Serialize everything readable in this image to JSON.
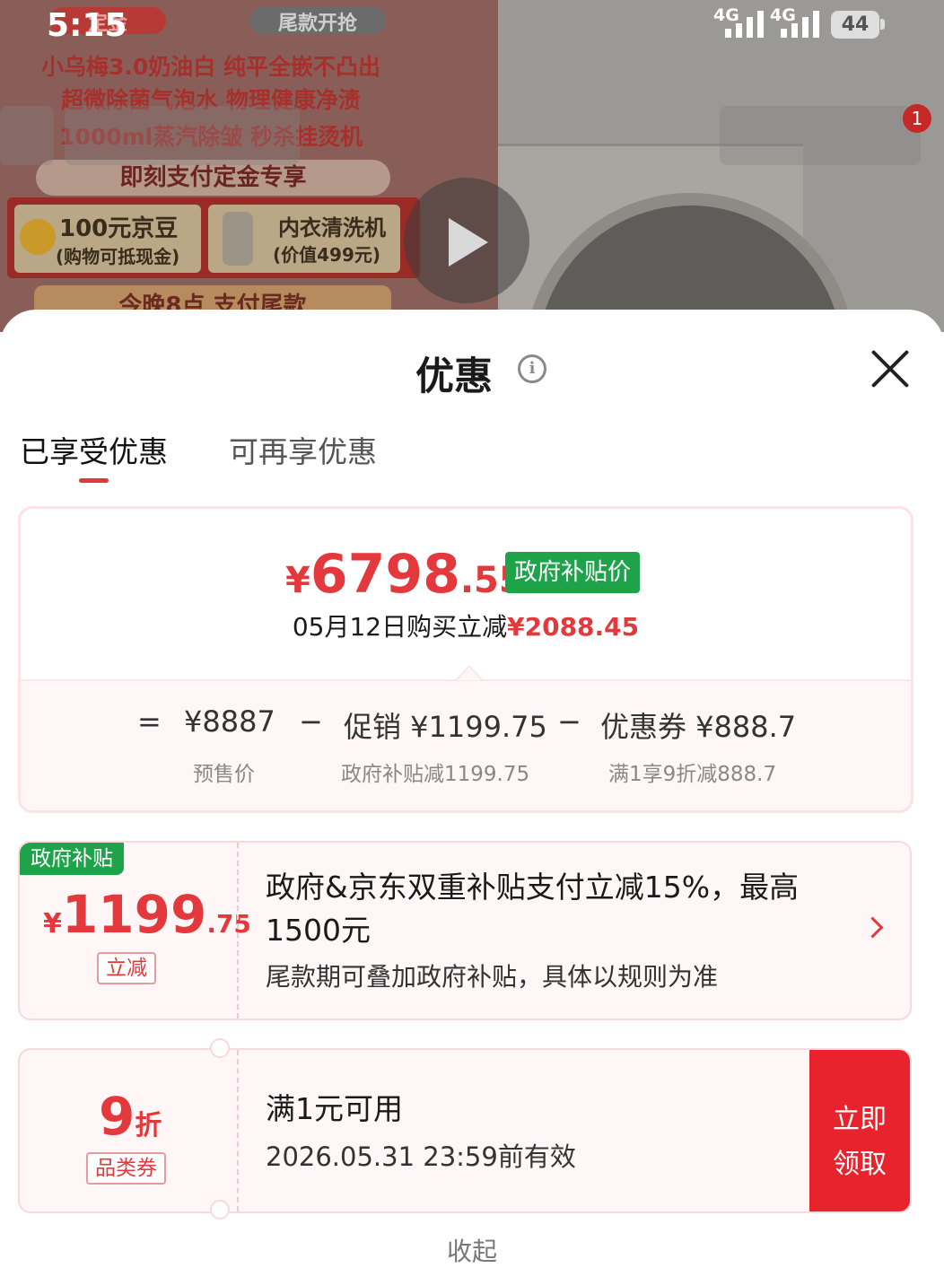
{
  "status_bar": {
    "time": "5:15",
    "signal_1": "4G",
    "signal_2": "4G",
    "battery": "44"
  },
  "background": {
    "poster_line_1": "小乌梅3.0奶油白 纯平全嵌不凸出",
    "poster_line_2": "超微除菌气泡水 物理健康净渍",
    "poster_line_3": "1000ml蒸汽除皱 秒杀挂烫机",
    "poster_banner": "即刻支付定金专享",
    "poster_pill_left": "定金",
    "poster_pill_right": "尾款开抢",
    "gift_1_title": "100元京豆",
    "gift_1_sub": "(购物可抵现金)",
    "gift_2_title": "内衣清洗机",
    "gift_2_sub": "(价值499元)",
    "poster_bottom": "今晚8点 支付尾款",
    "notification_count": "1"
  },
  "sheet": {
    "title": "优惠",
    "tabs": [
      "已享受优惠",
      "可再享优惠"
    ],
    "summary": {
      "currency": "¥",
      "price_int": "6798",
      "price_dec": ".55",
      "price_tag": "政府补贴价",
      "save_prefix": "05月12日购买立减",
      "save_amount": "¥2088.45",
      "eq_sign": "=",
      "presale": "¥8887",
      "minus": "−",
      "promo": "促销 ¥1199.75",
      "coupon": "优惠券 ¥888.7",
      "presale_label": "预售价",
      "promo_label": "政府补贴减1199.75",
      "coupon_label": "满1享9折减888.7"
    },
    "gov_card": {
      "corner_tag": "政府补贴",
      "currency": "¥",
      "amount_int": "1199",
      "amount_dec": ".75",
      "amount_tag": "立减",
      "desc_line_1": "政府&京东双重补贴支付立减15%，最高",
      "desc_line_2": "1500元",
      "desc_sub": "尾款期可叠加政府补贴，具体以规则为准"
    },
    "coupon_card": {
      "discount_num": "9",
      "discount_unit": "折",
      "tag": "品类券",
      "condition": "满1元可用",
      "validity": "2026.05.31 23:59前有效",
      "claim_line_1": "立即",
      "claim_line_2": "领取"
    },
    "collapse_label": "收起"
  }
}
